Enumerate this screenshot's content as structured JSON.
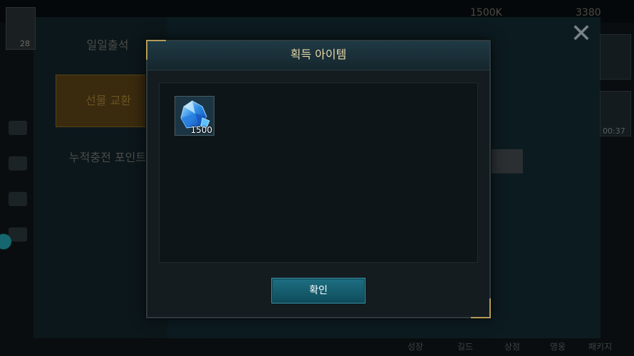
{
  "background": {
    "avatar_level": "28",
    "top_currency_1": "1500K",
    "top_currency_2": "3380",
    "menu_items": [
      {
        "label": "일일출석"
      },
      {
        "label": "선물 교환"
      },
      {
        "label": "누적충전 포인트"
      }
    ],
    "right_timer": "00:37",
    "bottom_nav": [
      "성장",
      "길드",
      "상점",
      "영웅",
      "패키지"
    ]
  },
  "modal": {
    "title": "획득 아이템",
    "items": [
      {
        "icon": "blue-gem-icon",
        "quantity": "1500"
      }
    ],
    "confirm_label": "확인"
  },
  "colors": {
    "title_text": "#e9d9a8",
    "confirm_button": "#1d6f82",
    "corner_accent": "#b59b58"
  }
}
